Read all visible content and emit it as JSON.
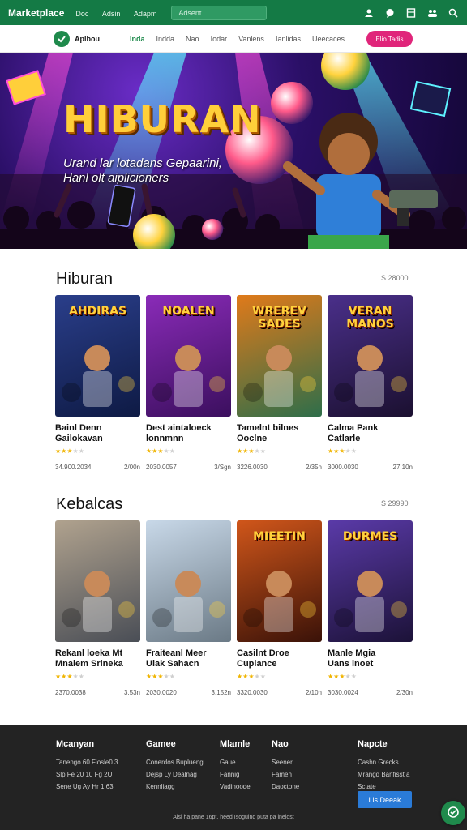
{
  "topbar": {
    "brand": "Marketplace",
    "nav": [
      "Doc",
      "Adsin",
      "Adapm"
    ],
    "search_value": "Adsent",
    "icons": [
      "user-icon",
      "chat-icon",
      "bookmark-icon",
      "group-icon",
      "search-icon"
    ]
  },
  "subnav": {
    "logo_text": "Aplbou",
    "items": [
      "Inda",
      "Indda",
      "Nao",
      "Iodar",
      "Vanlens",
      "Ianlidas",
      "Ueecaces"
    ],
    "cta": "Elio Tadis"
  },
  "hero": {
    "title": "HIBURAN",
    "subtitle_line1": "Urand lar lotadans Gepaarini,",
    "subtitle_line2": "Hanl olt aiplicioners"
  },
  "section1": {
    "title": "Hiburan",
    "meta": "S 28000",
    "cards": [
      {
        "thumb_label": "AHDIRAS",
        "title_l1": "Bainl Denn",
        "title_l2": "Gailokavan",
        "stars": 3,
        "meta_left": "34.900.2034",
        "meta_right": "2/00n",
        "c1": "#2a3e8a",
        "c2": "#0e1a44"
      },
      {
        "thumb_label": "NOALEN",
        "title_l1": "Dest aintaloeck",
        "title_l2": "lonnmnn",
        "stars": 3,
        "meta_left": "2030.0057",
        "meta_right": "3/Sgn",
        "c1": "#8a2bb8",
        "c2": "#3b0f5e"
      },
      {
        "thumb_label": "WREREV SADES",
        "title_l1": "Tamelnt bilnes",
        "title_l2": "Ooclne",
        "stars": 3,
        "meta_left": "3226.0030",
        "meta_right": "2/35n",
        "c1": "#e07a1a",
        "c2": "#2e6e4a"
      },
      {
        "thumb_label": "VERAN MANOS",
        "title_l1": "Calma Pank",
        "title_l2": "Catlarle",
        "stars": 3,
        "meta_left": "3000.0030",
        "meta_right": "27.10n",
        "c1": "#4a2f8a",
        "c2": "#1b1030"
      }
    ]
  },
  "section2": {
    "title": "Kebalcas",
    "meta": "S 29990",
    "cards": [
      {
        "thumb_label": "",
        "title_l1": "Rekanl loeka Mt",
        "title_l2": "Mnaiem Srineka",
        "stars": 3,
        "meta_left": "2370.0038",
        "meta_right": "3.53n",
        "c1": "#b0a28e",
        "c2": "#4a4e56"
      },
      {
        "thumb_label": "",
        "title_l1": "Fraiteanl Meer",
        "title_l2": "Ulak Sahacn",
        "stars": 3,
        "meta_left": "2030.0020",
        "meta_right": "3.152n",
        "c1": "#c8d8e8",
        "c2": "#6b7a86"
      },
      {
        "thumb_label": "MIEETIN",
        "title_l1": "Casilnt Droe",
        "title_l2": "Cuplance",
        "stars": 3,
        "meta_left": "3320.0030",
        "meta_right": "2/10n",
        "c1": "#d0561a",
        "c2": "#3a1208"
      },
      {
        "thumb_label": "DURMES",
        "title_l1": "Manle Mgia",
        "title_l2": "Uans lnoet",
        "stars": 3,
        "meta_left": "3030.0024",
        "meta_right": "2/30n",
        "c1": "#5a3aa8",
        "c2": "#1c1238"
      }
    ]
  },
  "footer": {
    "columns": [
      {
        "head": "Mcanyan",
        "links": [
          "Tanengo 60 Fiosle0 3",
          "Slp Fe 20 10 Fg 2U",
          "Sene Ug Ay Hr 1 63"
        ]
      },
      {
        "head": "Gamee",
        "links": [
          "Conerdos Buplueng",
          "Dejsp Ly Dealnag",
          "Kennliagg"
        ]
      },
      {
        "head": "Mlamle",
        "links": [
          "Gaue",
          "Fannig",
          "Vadinoode"
        ]
      },
      {
        "head": "Nao",
        "links": [
          "Seener",
          "Famen",
          "Daoctone"
        ]
      },
      {
        "head": "Napcte",
        "links": [
          "Cashn Grecks",
          "Mrangd Banfisst a",
          "Sctate"
        ]
      }
    ],
    "button": "Lis Deeak",
    "copyright": "Alsi ha pane 16pt. heed Isoguind puta pa lnelost"
  },
  "colors": {
    "brand_green": "#147a45",
    "cta_pink": "#e0257a",
    "footer_bg": "#232323",
    "footer_button": "#2a7bd8",
    "star": "#f0b400"
  }
}
